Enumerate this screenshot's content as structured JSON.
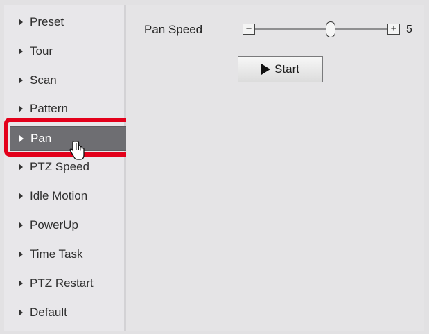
{
  "sidebar": {
    "items": [
      {
        "label": "Preset",
        "active": false
      },
      {
        "label": "Tour",
        "active": false
      },
      {
        "label": "Scan",
        "active": false
      },
      {
        "label": "Pattern",
        "active": false
      },
      {
        "label": "Pan",
        "active": true
      },
      {
        "label": "PTZ Speed",
        "active": false
      },
      {
        "label": "Idle Motion",
        "active": false
      },
      {
        "label": "PowerUp",
        "active": false
      },
      {
        "label": "Time Task",
        "active": false
      },
      {
        "label": "PTZ Restart",
        "active": false
      },
      {
        "label": "Default",
        "active": false
      }
    ]
  },
  "main": {
    "pan_speed": {
      "label": "Pan Speed",
      "minus_label": "−",
      "plus_label": "+",
      "value": "5"
    },
    "start_button": {
      "label": "Start",
      "icon": "play-icon"
    }
  },
  "icons": {
    "nav_arrow": "triangle-right",
    "cursor": "hand-pointer-icon"
  },
  "colors": {
    "highlight": "#e3001b",
    "active_item_bg": "#6e6e72"
  }
}
